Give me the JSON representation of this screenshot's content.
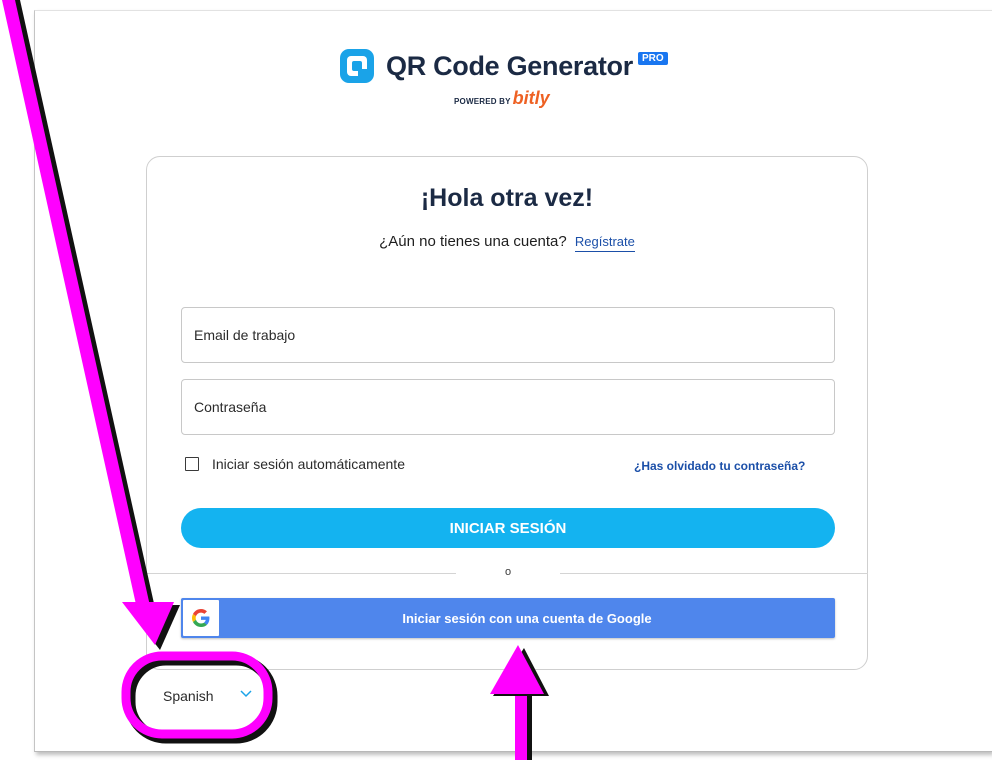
{
  "brand": {
    "name": "QR Code Generator",
    "badge": "PRO",
    "powered_by": "POWERED BY",
    "partner": "bitly",
    "logo_color": "#1aa3e8"
  },
  "login": {
    "heading": "¡Hola otra vez!",
    "no_account": "¿Aún no tienes una cuenta?",
    "signup_link": "Regístrate",
    "email_placeholder": "Email de trabajo",
    "password_placeholder": "Contraseña",
    "remember_label": "Iniciar sesión automáticamente",
    "remember_checked": false,
    "forgot_link": "¿Has olvidado tu contraseña?",
    "submit_label": "INICIAR SESIÓN",
    "or_label": "o",
    "google_label": "Iniciar sesión con una cuenta de Google"
  },
  "footer": {
    "language": "Spanish"
  },
  "annotations": {
    "color": "#ff00ff",
    "icons": [
      "arrow-annotation",
      "arrow-annotation",
      "highlight-ring-annotation"
    ]
  }
}
